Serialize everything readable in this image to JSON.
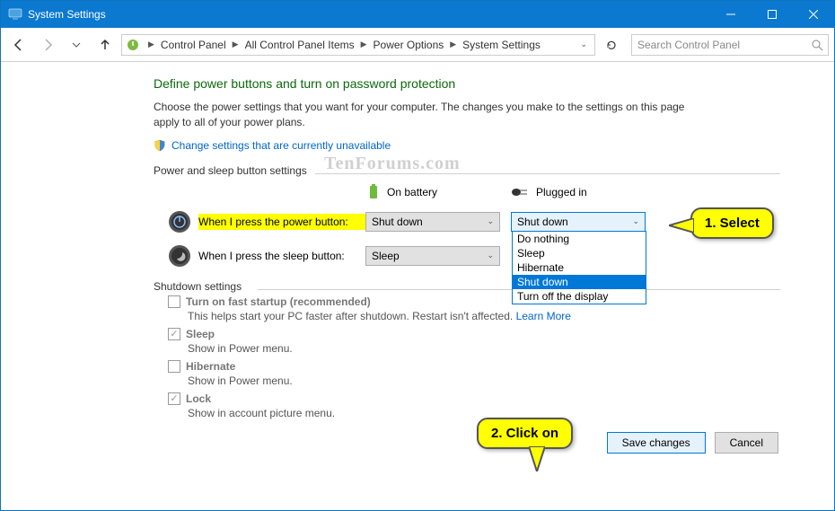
{
  "window": {
    "title": "System Settings"
  },
  "breadcrumb": [
    "Control Panel",
    "All Control Panel Items",
    "Power Options",
    "System Settings"
  ],
  "search": {
    "placeholder": "Search Control Panel"
  },
  "heading": "Define power buttons and turn on password protection",
  "description": "Choose the power settings that you want for your computer. The changes you make to the settings on this page apply to all of your power plans.",
  "change_link": "Change settings that are currently unavailable",
  "section1": "Power and sleep button settings",
  "cols": {
    "battery": "On battery",
    "plugged": "Plugged in"
  },
  "rows": {
    "power": {
      "label": "When I press the power button:",
      "battery": "Shut down",
      "plugged": "Shut down"
    },
    "sleep": {
      "label": "When I press the sleep button:",
      "battery": "Sleep"
    }
  },
  "dropdown": [
    "Do nothing",
    "Sleep",
    "Hibernate",
    "Shut down",
    "Turn off the display"
  ],
  "section2": "Shutdown settings",
  "shutdown": {
    "fast": {
      "label": "Turn on fast startup (recommended)",
      "sub": "This helps start your PC faster after shutdown. Restart isn't affected.",
      "learn": "Learn More"
    },
    "sleep": {
      "label": "Sleep",
      "sub": "Show in Power menu."
    },
    "hibernate": {
      "label": "Hibernate",
      "sub": "Show in Power menu."
    },
    "lock": {
      "label": "Lock",
      "sub": "Show in account picture menu."
    }
  },
  "buttons": {
    "save": "Save changes",
    "cancel": "Cancel"
  },
  "callouts": {
    "c1": "1. Select",
    "c2": "2. Click on"
  },
  "watermark": "TenForums.com"
}
